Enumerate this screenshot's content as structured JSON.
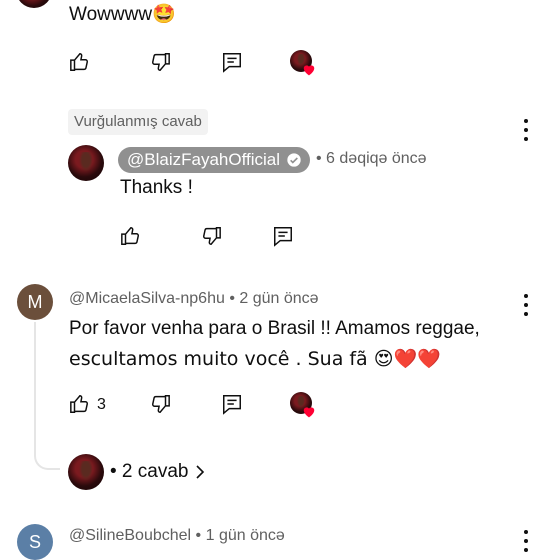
{
  "top_comment": {
    "text": "Wowwww🤩"
  },
  "highlighted": {
    "chip_label": "Vurğulanmış cavab",
    "author": "@BlaizFayahOfficial",
    "time": "• 6 dəqiqə öncə",
    "text": "Thanks !"
  },
  "comment_micaela": {
    "avatar_letter": "M",
    "avatar_color": "#6b4f3b",
    "author": "@MicaelaSilva-np6hu",
    "time": "• 2 gün öncə",
    "text_line1": "Por favor venha para o Brasil !! Amamos reggae,",
    "text_line2": "escultamos muito você . Sua fã 😍❤️❤️",
    "like_count": "3",
    "replies_label": "• 2 cavab"
  },
  "comment_siline": {
    "avatar_letter": "S",
    "avatar_color": "#5b7fa6",
    "author": "@SilineBoubchel",
    "time": "• 1 gün öncə"
  },
  "icons": {
    "like": "thumb-up-icon",
    "dislike": "thumb-down-icon",
    "reply": "reply-comment-icon",
    "more": "more-vert-icon",
    "verified": "verified-check-icon",
    "heart": "heart-icon",
    "chevron": "chevron-right-icon"
  },
  "colors": {
    "heart": "#ff0033",
    "chip_bg": "#f2f2f2",
    "owner_chip_bg": "#909090"
  }
}
